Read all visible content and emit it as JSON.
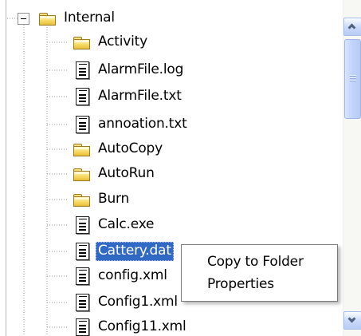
{
  "tree": {
    "root": {
      "label": "Internal",
      "icon": "folder-icon",
      "expander_icon": "minus-expander-icon"
    },
    "children": [
      {
        "label": "Activity",
        "icon": "folder-icon"
      },
      {
        "label": "AlarmFile.log",
        "icon": "file-icon"
      },
      {
        "label": "AlarmFile.txt",
        "icon": "file-icon"
      },
      {
        "label": "annoation.txt",
        "icon": "file-icon"
      },
      {
        "label": "AutoCopy",
        "icon": "folder-icon"
      },
      {
        "label": "AutoRun",
        "icon": "folder-icon"
      },
      {
        "label": "Burn",
        "icon": "folder-icon"
      },
      {
        "label": "Calc.exe",
        "icon": "file-icon"
      },
      {
        "label": "Cattery.dat",
        "icon": "file-icon",
        "selected": true
      },
      {
        "label": "config.xml",
        "icon": "file-icon"
      },
      {
        "label": "Config1.xml",
        "icon": "file-icon"
      },
      {
        "label": "Config11.xml",
        "icon": "file-icon"
      }
    ]
  },
  "context_menu": {
    "items": [
      {
        "label": "Copy to Folder"
      },
      {
        "label": "Properties"
      }
    ]
  },
  "scrollbar": {
    "position": 0.12,
    "up_icon": "chevron-up-icon",
    "down_icon": "chevron-down-icon"
  },
  "colors": {
    "selection": "#316ac5",
    "folder": "#f7da62",
    "scrollbar_button": "#c9d8fb"
  }
}
